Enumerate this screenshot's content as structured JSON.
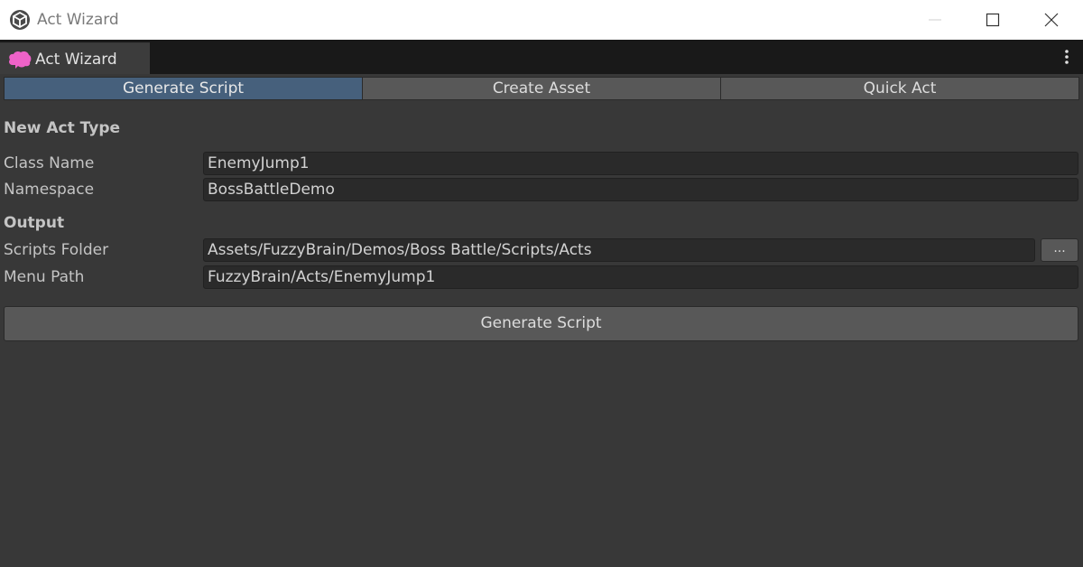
{
  "window": {
    "title": "Act Wizard",
    "icons": {
      "app": "unity-cube-icon",
      "minimize": "minimize-icon",
      "maximize": "maximize-icon",
      "close": "close-icon"
    }
  },
  "panel_tab": {
    "label": "Act Wizard",
    "icon": "brain-icon",
    "icon_color": "#ee62c8",
    "menu_icon": "kebab-menu-icon"
  },
  "toolbar": {
    "tabs": [
      {
        "label": "Generate Script",
        "active": true
      },
      {
        "label": "Create Asset",
        "active": false
      },
      {
        "label": "Quick Act",
        "active": false
      }
    ],
    "active_color": "#46607c"
  },
  "form": {
    "new_act_type": {
      "heading": "New Act Type",
      "class_name": {
        "label": "Class Name",
        "value": "EnemyJump1"
      },
      "namespace": {
        "label": "Namespace",
        "value": "BossBattleDemo"
      }
    },
    "output": {
      "heading": "Output",
      "scripts_folder": {
        "label": "Scripts Folder",
        "value": "Assets/FuzzyBrain/Demos/Boss Battle/Scripts/Acts",
        "browse_label": "..."
      },
      "menu_path": {
        "label": "Menu Path",
        "value": "FuzzyBrain/Acts/EnemyJump1"
      }
    },
    "generate_button": "Generate Script"
  }
}
